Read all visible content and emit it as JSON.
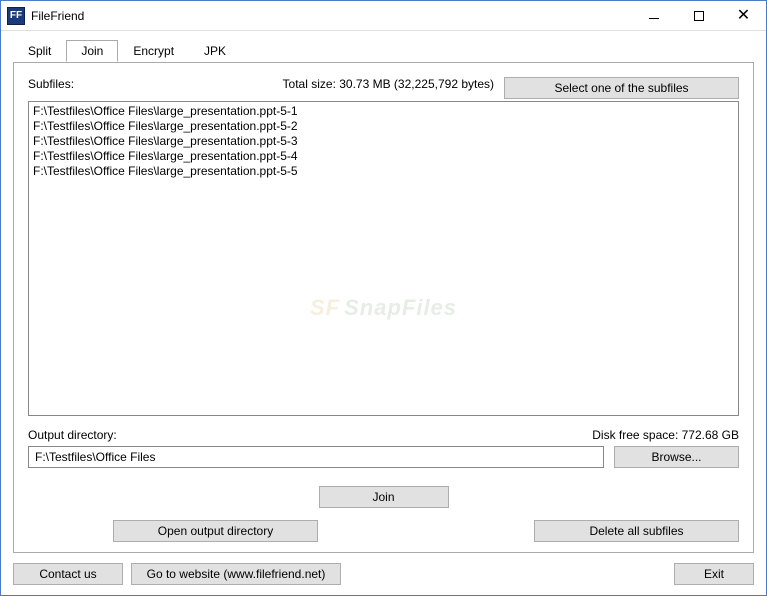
{
  "app": {
    "title": "FileFriend",
    "iconText": "FF"
  },
  "tabs": {
    "split": "Split",
    "join": "Join",
    "encrypt": "Encrypt",
    "jpk": "JPK"
  },
  "subfiles": {
    "label": "Subfiles:",
    "totalSize": "Total size: 30.73 MB (32,225,792 bytes)",
    "selectBtn": "Select one of the subfiles",
    "items": [
      "F:\\Testfiles\\Office Files\\large_presentation.ppt-5-1",
      "F:\\Testfiles\\Office Files\\large_presentation.ppt-5-2",
      "F:\\Testfiles\\Office Files\\large_presentation.ppt-5-3",
      "F:\\Testfiles\\Office Files\\large_presentation.ppt-5-4",
      "F:\\Testfiles\\Office Files\\large_presentation.ppt-5-5"
    ]
  },
  "output": {
    "label": "Output directory:",
    "diskFree": "Disk free space: 772.68 GB",
    "value": "F:\\Testfiles\\Office Files",
    "browseBtn": "Browse..."
  },
  "actions": {
    "join": "Join",
    "openOutput": "Open output directory",
    "deleteAll": "Delete all subfiles"
  },
  "footer": {
    "contact": "Contact us",
    "website": "Go to website (www.filefriend.net)",
    "exit": "Exit"
  },
  "watermark": {
    "text": "SnapFiles",
    "icon": "SF"
  }
}
